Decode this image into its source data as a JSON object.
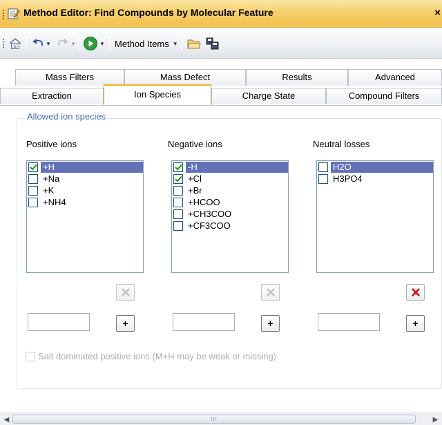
{
  "window": {
    "title": "Method Editor: Find Compounds by Molecular Feature",
    "close_glyph": "×"
  },
  "toolbar": {
    "method_items_label": "Method Items"
  },
  "tabs_back": [
    "Mass Filters",
    "Mass Defect",
    "Results",
    "Advanced"
  ],
  "tabs_front": [
    "Extraction",
    "Ion Species",
    "Charge State",
    "Compound Filters"
  ],
  "active_tab": "Ion Species",
  "group_title": "Allowed ion species",
  "columns": {
    "positive": {
      "label": "Positive ions",
      "items": [
        {
          "label": "+H",
          "checked": true,
          "selected": true
        },
        {
          "label": "+Na",
          "checked": false
        },
        {
          "label": "+K",
          "checked": false
        },
        {
          "label": "+NH4",
          "checked": false
        }
      ],
      "delete_enabled": false,
      "input_value": ""
    },
    "negative": {
      "label": "Negative ions",
      "items": [
        {
          "label": "-H",
          "checked": true,
          "selected": true
        },
        {
          "label": "+Cl",
          "checked": true
        },
        {
          "label": "+Br",
          "checked": false
        },
        {
          "label": "+HCOO",
          "checked": false
        },
        {
          "label": "+CH3COO",
          "checked": false
        },
        {
          "label": "+CF3COO",
          "checked": false
        }
      ],
      "delete_enabled": false,
      "input_value": ""
    },
    "neutral": {
      "label": "Neutral losses",
      "items": [
        {
          "label": "H2O",
          "checked": false,
          "selected": true
        },
        {
          "label": "H3PO4",
          "checked": false
        }
      ],
      "delete_enabled": true,
      "input_value": ""
    }
  },
  "add_button_label": "+",
  "salt_option": {
    "label": "Salt dominated positive ions (M+H may be weak or missing)",
    "checked": false,
    "enabled": false
  },
  "scrollbar": {
    "thumb_grip": "III"
  },
  "colors": {
    "selection": "#6371b7",
    "delete_active": "#d40000",
    "delete_disabled": "#a8adb3"
  }
}
